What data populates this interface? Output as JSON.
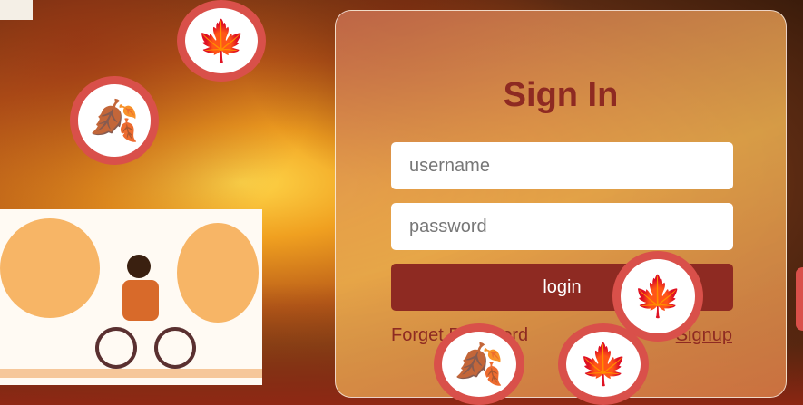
{
  "form": {
    "title": "Sign In",
    "username_placeholder": "username",
    "password_placeholder": "password",
    "login_label": "login",
    "forgot_label": "Forget Password",
    "signup_label": "Signup"
  },
  "colors": {
    "accent": "#8e2a22",
    "leaf_ring": "#d9504a"
  },
  "decor": {
    "leaf_icon": "🍁",
    "oak_icon": "🍂"
  }
}
